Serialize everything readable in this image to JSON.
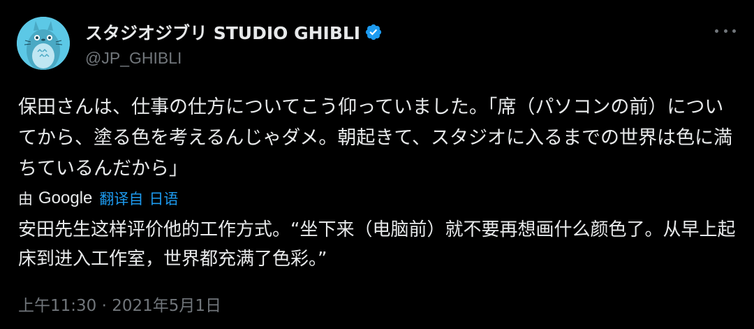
{
  "tweet": {
    "display_name": "スタジオジブリ STUDIO GHIBLI",
    "handle": "@JP_GHIBLI",
    "text_original": "保田さんは、仕事の仕方についてこう仰っていました。「席（パソコンの前）についてから、塗る色を考えるんじゃダメ。朝起きて、スタジオに入るまでの世界は色に満ちているんだから」",
    "translation": {
      "by_label": "由",
      "provider": "Google",
      "translated_from_label": "翻译自",
      "language": "日语",
      "text": "安田先生这样评价他的工作方式。“坐下来（电脑前）就不要再想画什么颜色了。从早上起床到进入工作室，世界都充满了色彩。”"
    },
    "timestamp": "上午11:30 · 2021年5月1日"
  },
  "icons": {
    "verified": "verified-badge-icon",
    "more": "more-horizontal-icon",
    "avatar": "totoro-avatar"
  },
  "colors": {
    "background": "#000000",
    "text": "#e7e9ea",
    "secondary": "#71767b",
    "accent": "#1d9bf0",
    "avatar_bg": "#5cc8e6"
  }
}
